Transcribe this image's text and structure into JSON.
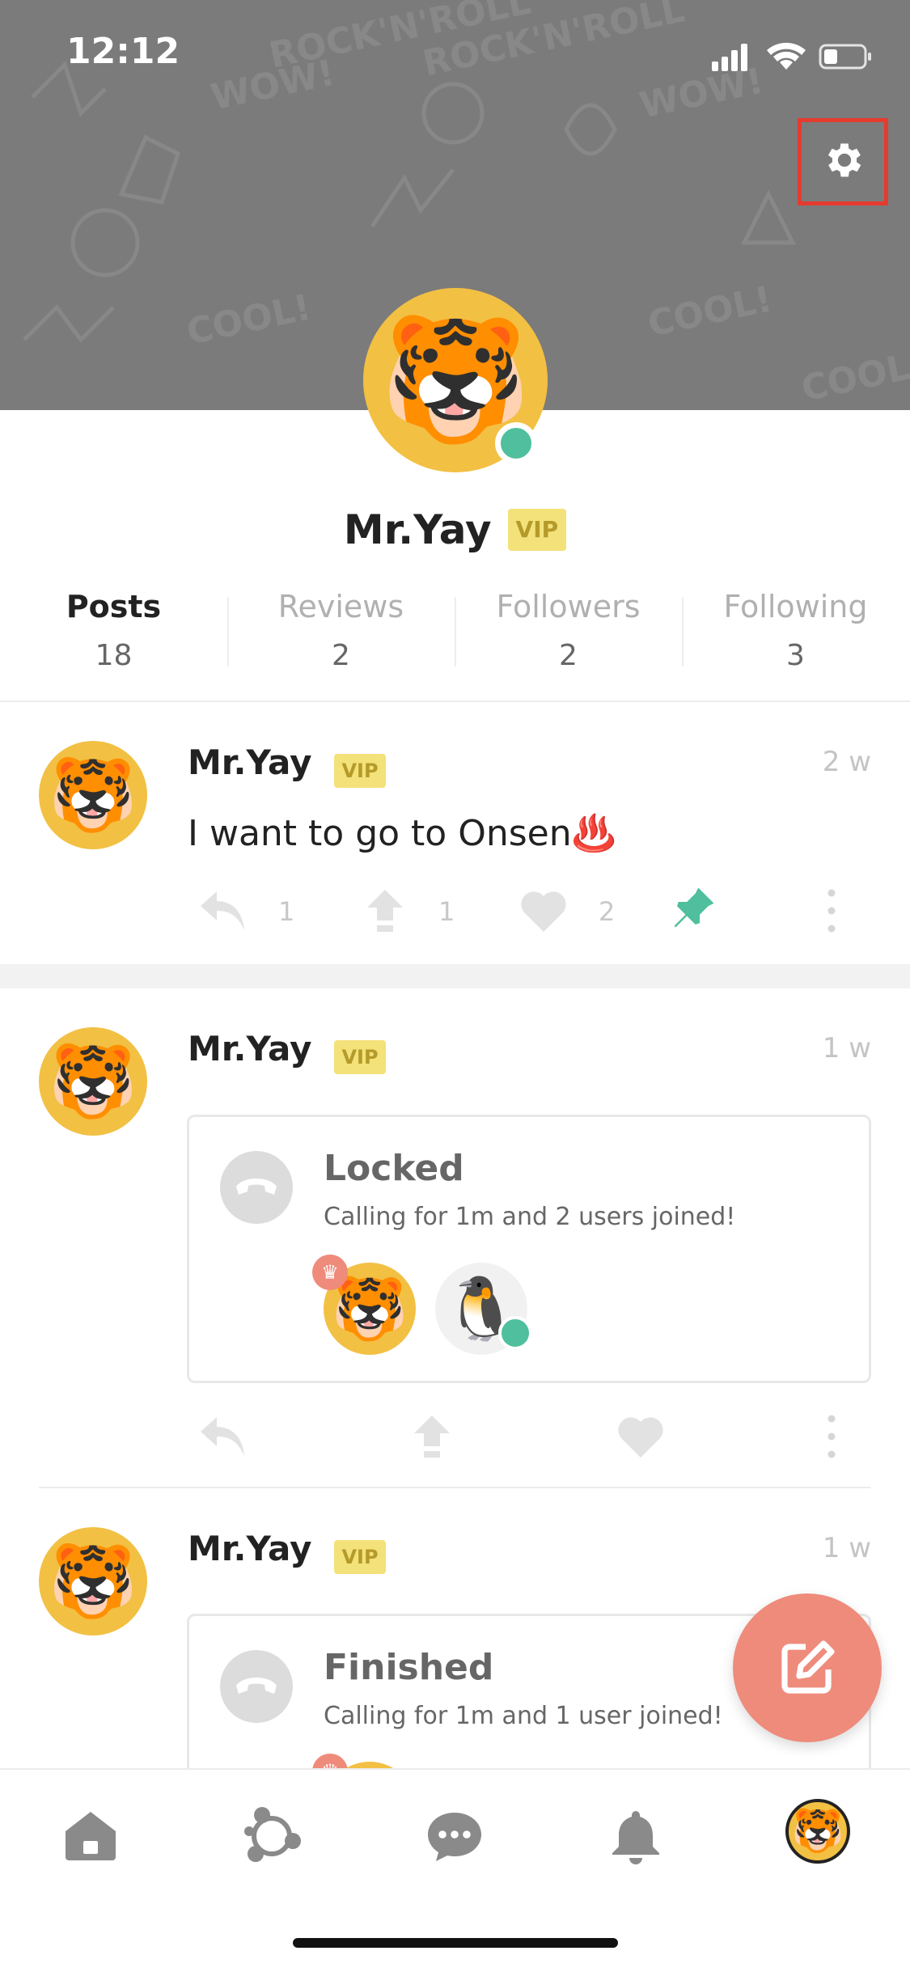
{
  "status_bar": {
    "time": "12:12"
  },
  "profile": {
    "name": "Mr.Yay",
    "badge": "VIP",
    "avatar_emoji": "🐯",
    "online": true
  },
  "tabs": [
    {
      "label": "Posts",
      "count": "18",
      "active": true
    },
    {
      "label": "Reviews",
      "count": "2",
      "active": false
    },
    {
      "label": "Followers",
      "count": "2",
      "active": false
    },
    {
      "label": "Following",
      "count": "3",
      "active": false
    }
  ],
  "posts": [
    {
      "author": "Mr.Yay",
      "badge": "VIP",
      "time": "2 w",
      "text": "I want to go to Onsen♨️",
      "reply_count": "1",
      "share_count": "1",
      "like_count": "2"
    },
    {
      "author": "Mr.Yay",
      "badge": "VIP",
      "time": "1 w",
      "call_title": "Locked",
      "call_subtitle": "Calling for 1m and 2 users joined!"
    },
    {
      "author": "Mr.Yay",
      "badge": "VIP",
      "time": "1 w",
      "call_title": "Finished",
      "call_subtitle": "Calling for 1m and 1 user joined!"
    }
  ],
  "icons": {
    "settings": "gear-icon",
    "reply": "reply-icon",
    "share": "share-arrow-icon",
    "like": "heart-icon",
    "pin": "pin-icon",
    "more": "more-vertical-icon",
    "compose": "compose-icon",
    "nav": [
      "home-icon",
      "network-icon",
      "chat-bubble-icon",
      "bell-icon",
      "profile-avatar-icon"
    ]
  },
  "colors": {
    "accent_green": "#4fbf9d",
    "fab": "#ef8b7b",
    "vip_bg": "#f3e27a",
    "highlight_frame": "#e53b2f"
  },
  "joined_users": [
    "🐯",
    "🐧"
  ]
}
